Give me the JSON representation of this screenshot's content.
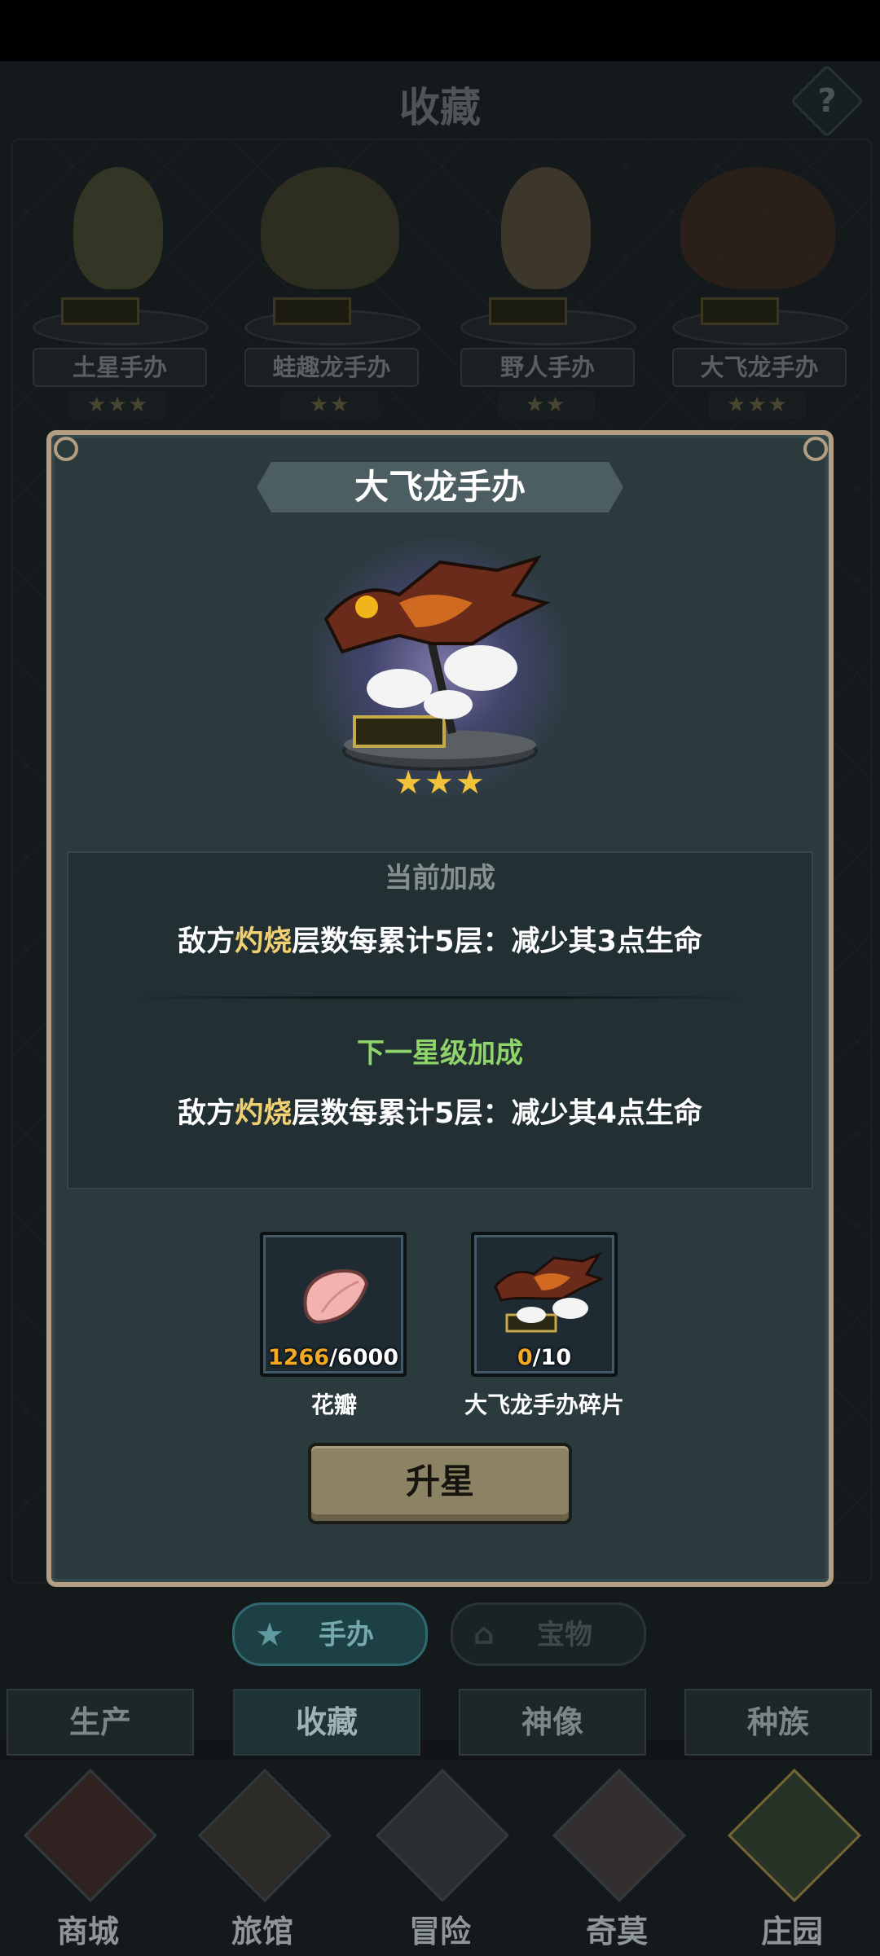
{
  "page": {
    "title": "收藏",
    "help": "?"
  },
  "shelf": [
    {
      "name": "土星手办",
      "stars": "★★★"
    },
    {
      "name": "蛙趣龙手办",
      "stars": "★★"
    },
    {
      "name": "野人手办",
      "stars": "★★"
    },
    {
      "name": "大飞龙手办",
      "stars": "★★★"
    }
  ],
  "dialog": {
    "title": "大飞龙手办",
    "stars": "★★★",
    "current_label": "当前加成",
    "current_bonus": {
      "pre": "敌方",
      "highlight": "灼烧",
      "post": "层数每累计5层：减少其3点生命"
    },
    "next_label": "下一星级加成",
    "next_bonus": {
      "pre": "敌方",
      "highlight": "灼烧",
      "post": "层数每累计5层：减少其4点生命"
    },
    "materials": [
      {
        "name": "花瓣",
        "current": "1266",
        "required": "/6000"
      },
      {
        "name": "大飞龙手办碎片",
        "current": "0",
        "required": "/10"
      }
    ],
    "upgrade_label": "升星"
  },
  "subtabs": [
    {
      "label": "手办",
      "icon": "star-icon"
    },
    {
      "label": "宝物",
      "icon": "chest-icon"
    }
  ],
  "category_tabs": [
    "生产",
    "收藏",
    "神像",
    "种族"
  ],
  "bottom_nav": [
    {
      "label": "商城",
      "icon": "shop-icon"
    },
    {
      "label": "旅馆",
      "icon": "inn-icon"
    },
    {
      "label": "冒险",
      "icon": "crossed-swords-icon"
    },
    {
      "label": "奇莫",
      "icon": "creature-icon"
    },
    {
      "label": "庄园",
      "icon": "manor-icon"
    }
  ],
  "colors": {
    "highlight": "#f0d070",
    "next_bonus": "#8fd46a",
    "count_current": "#f3a923",
    "frame": "#b49e83"
  }
}
